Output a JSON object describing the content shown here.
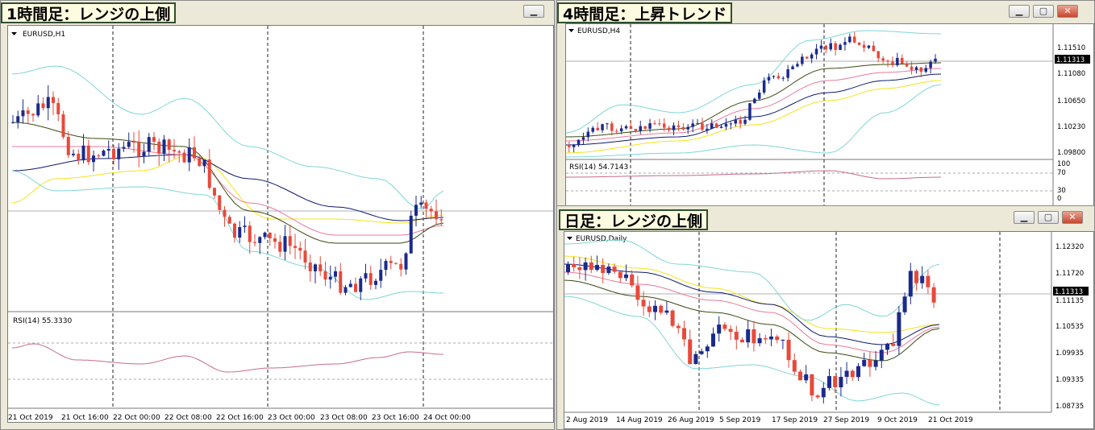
{
  "windows": {
    "h1": {
      "tag": "1時間足：レンジの上側",
      "symbol": "EURUSD,H1",
      "rsi_label": "RSI(14) 55.3330",
      "time_labels": [
        "21 Oct 2019",
        "21 Oct 16:00",
        "22 Oct 00:00",
        "22 Oct 08:00",
        "22 Oct 16:00",
        "23 Oct 00:00",
        "23 Oct 08:00",
        "23 Oct 16:00",
        "24 Oct 00:00"
      ]
    },
    "h4": {
      "tag": "4時間足：上昇トレンド",
      "symbol": "EURUSD,H4",
      "rsi_label": "RSI(14) 54.7143",
      "price_labels": [
        "1.11510",
        "1.11313",
        "1.11080",
        "1.10650",
        "1.10230",
        "1.09800"
      ],
      "current_price": "1.11313",
      "rsi_levels": [
        "100",
        "70",
        "30",
        "0"
      ]
    },
    "daily": {
      "tag": "日足：レンジの上側",
      "symbol": "EURUSD,Daily",
      "price_labels": [
        "1.12320",
        "1.11720",
        "1.11313",
        "1.11135",
        "1.10535",
        "1.09935",
        "1.09335",
        "1.08735"
      ],
      "current_price": "1.11313",
      "time_labels": [
        "2 Aug 2019",
        "14 Aug 2019",
        "26 Aug 2019",
        "5 Sep 2019",
        "17 Sep 2019",
        "27 Sep 2019",
        "9 Oct 2019",
        "21 Oct 2019"
      ]
    }
  },
  "buttons": {
    "minimize": "▁",
    "restore": "▢",
    "close": "✕"
  },
  "colors": {
    "bull": "#e8493a",
    "bear": "#1a2a8c",
    "bb": "#7fd6d6",
    "ma_yellow": "#f5e31a",
    "ma_navy": "#0d1a6e",
    "ma_pink": "#e87a9a",
    "ma_olive": "#3a4a10",
    "rsi": "#c86a8a"
  }
}
